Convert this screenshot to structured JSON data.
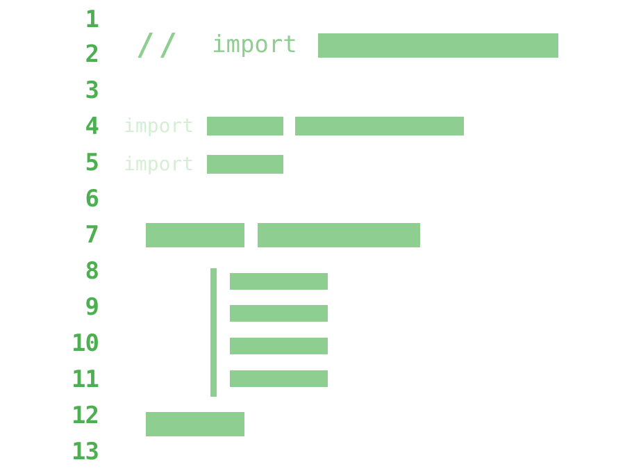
{
  "editor": {
    "line_numbers": [
      "1",
      "2",
      "3",
      "4",
      "5",
      "6",
      "7",
      "8",
      "9",
      "10",
      "11",
      "12",
      "13"
    ],
    "comment_marker": "//",
    "import_keyword": "import",
    "colors": {
      "line_number": "#4caf50",
      "placeholder_block": "#8fce91",
      "keyword_strong": "#8fce91",
      "keyword_faint": "#d5eed5",
      "background": "#ffffff"
    }
  }
}
